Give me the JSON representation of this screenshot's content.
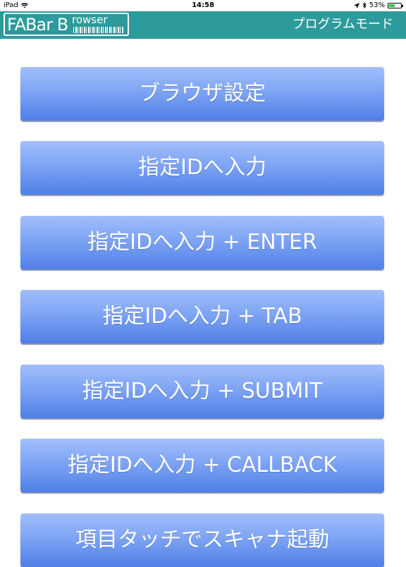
{
  "status_bar": {
    "device": "iPad",
    "time": "14:58",
    "battery": "53%",
    "battery_level": 0.53
  },
  "header": {
    "logo_main": "FABar B",
    "logo_sub": "rowser",
    "title": "プログラムモード"
  },
  "menu": {
    "items": [
      {
        "label": "ブラウザ設定"
      },
      {
        "label": "指定IDへ入力"
      },
      {
        "label": "指定IDへ入力 + ENTER"
      },
      {
        "label": "指定IDへ入力 + TAB"
      },
      {
        "label": "指定IDへ入力 + SUBMIT"
      },
      {
        "label": "指定IDへ入力 + CALLBACK"
      },
      {
        "label": "項目タッチでスキャナ起動"
      }
    ]
  },
  "colors": {
    "nav_bar": "#2d9a9b",
    "button_top": "#a2bffa",
    "button_bottom": "#4f7fe6"
  }
}
